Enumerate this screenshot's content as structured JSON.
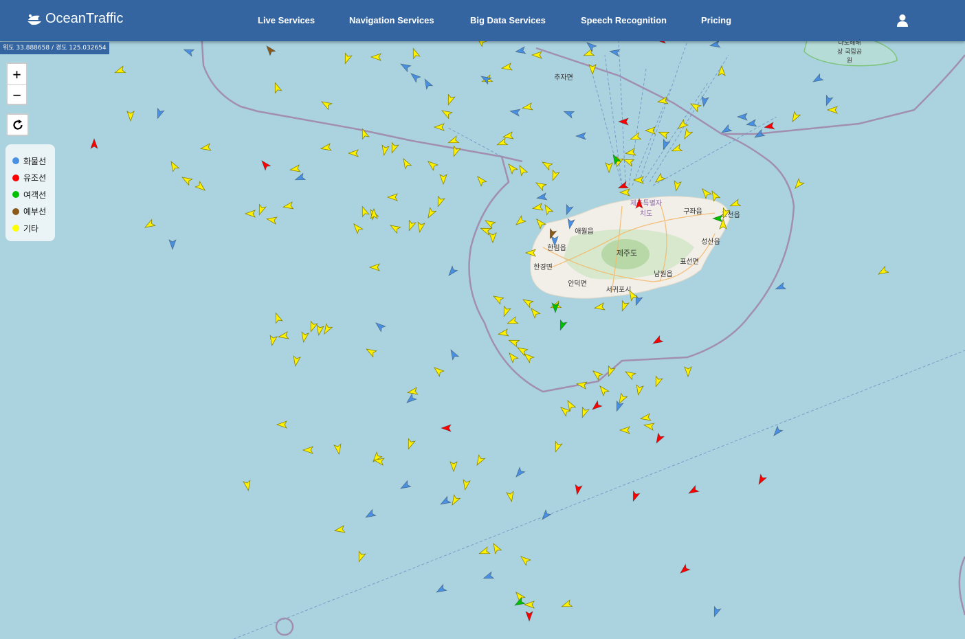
{
  "header": {
    "brand": "OceanTraffic",
    "nav": [
      {
        "label": "Live Services"
      },
      {
        "label": "Navigation Services"
      },
      {
        "label": "Big Data Services"
      },
      {
        "label": "Speech Recognition"
      },
      {
        "label": "Pricing"
      }
    ],
    "user_icon": "user-icon"
  },
  "coordinates": "위도 33.888658 / 경도 125.032654",
  "controls": {
    "zoom_in": "+",
    "zoom_out": "−",
    "reset_icon": "refresh-icon"
  },
  "legend": [
    {
      "label": "화물선",
      "color": "#4a90e2"
    },
    {
      "label": "유조선",
      "color": "#ff0000"
    },
    {
      "label": "여객선",
      "color": "#00c000"
    },
    {
      "label": "예부선",
      "color": "#8b5a1a"
    },
    {
      "label": "기타",
      "color": "#ffff00"
    }
  ],
  "map": {
    "sea_color": "#aad3df",
    "island_name": "제주도",
    "places": [
      "추자면",
      "제주특별자치도",
      "구좌읍",
      "조천읍",
      "애월읍",
      "한림읍",
      "한경면",
      "안덕면",
      "서귀포시",
      "남원읍",
      "표선면",
      "성산읍",
      "다도해해상국립공원"
    ]
  }
}
